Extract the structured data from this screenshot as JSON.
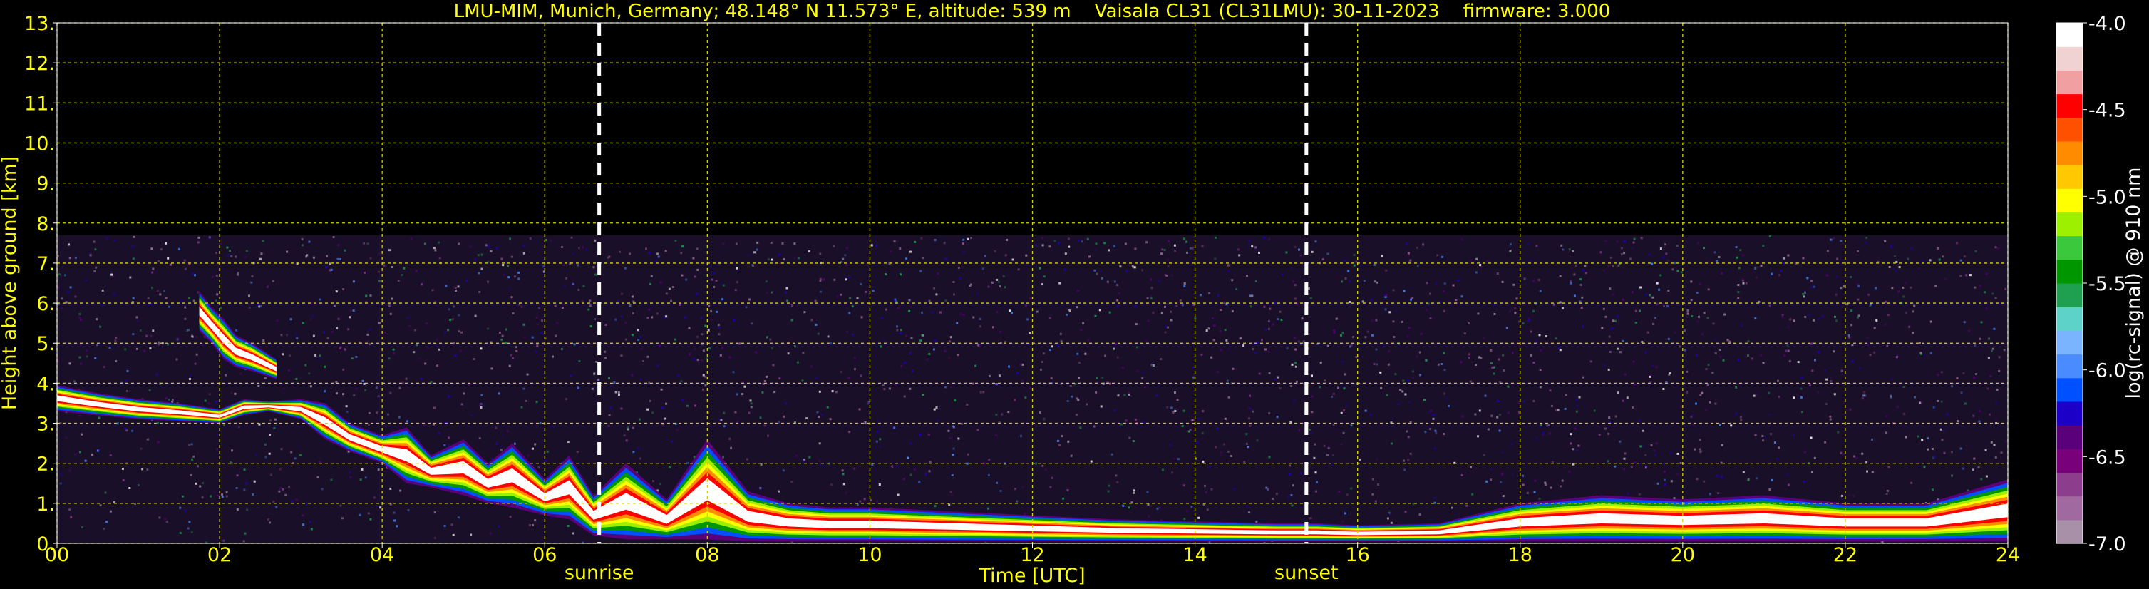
{
  "chart_data": {
    "type": "heatmap",
    "title": "LMU-MIM, Munich, Germany; 48.148° N 11.573° E, altitude: 539 m    Vaisala CL31 (CL31LMU): 30-11-2023    firmware: 3.000",
    "xlabel": "Time [UTC]",
    "ylabel": "Height above ground [km]",
    "xlim": [
      0,
      24
    ],
    "ylim": [
      0,
      13
    ],
    "x_ticks": [
      0,
      2,
      4,
      6,
      8,
      10,
      12,
      14,
      16,
      18,
      20,
      22,
      24
    ],
    "x_tick_labels": [
      "00",
      "02",
      "04",
      "06",
      "08",
      "10",
      "12",
      "14",
      "16",
      "18",
      "20",
      "22",
      "24"
    ],
    "y_ticks": [
      0,
      1,
      2,
      3,
      4,
      5,
      6,
      7,
      8,
      9,
      10,
      11,
      12,
      13
    ],
    "y_tick_labels": [
      "0.",
      "1.",
      "2.",
      "3.",
      "4.",
      "5.",
      "6.",
      "7.",
      "8.",
      "9.",
      "10.",
      "11.",
      "12.",
      "13."
    ],
    "grid": true,
    "grid_color": "#d4d400",
    "text_color": "#ffff00",
    "background": "#000000",
    "max_range_km": 7.7,
    "annotations": [
      {
        "label": "sunrise",
        "x": 6.67
      },
      {
        "label": "sunset",
        "x": 15.37
      }
    ],
    "colorbar": {
      "label": "log(rc-signal) @ 910 nm",
      "range": [
        -7.0,
        -4.0
      ],
      "tick_values": [
        -4.0,
        -4.5,
        -5.0,
        -5.5,
        -6.0,
        -6.5,
        -7.0
      ],
      "tick_labels": [
        "-4.0",
        "-4.5",
        "-5.0",
        "-5.5",
        "-6.0",
        "-6.5",
        "-7.0"
      ],
      "colors": [
        "#a890a8",
        "#a06aa0",
        "#8c3d8c",
        "#780078",
        "#5a007a",
        "#1c00c8",
        "#0050ff",
        "#4a8cff",
        "#7ab4ff",
        "#5cd2c8",
        "#1ea050",
        "#009600",
        "#3cc83c",
        "#9cf000",
        "#ffff00",
        "#ffc800",
        "#ff8c00",
        "#ff5000",
        "#ff0000",
        "#f0a0a0",
        "#f0d2d2",
        "#ffffff"
      ]
    },
    "layers": [
      {
        "name": "residual layer",
        "time": [
          0,
          0.5,
          1,
          1.5,
          2,
          2.3,
          2.6,
          3,
          3.3,
          3.6,
          4,
          4.3,
          4.6,
          5,
          5.3,
          5.6,
          6,
          6.3,
          6.6,
          7,
          7.5,
          8,
          8.5,
          9,
          9.5,
          10,
          11,
          12,
          13,
          14,
          15,
          15.5,
          16,
          17,
          18,
          19,
          20,
          21,
          22,
          23,
          24
        ],
        "top": [
          3.95,
          3.75,
          3.6,
          3.5,
          3.35,
          3.6,
          3.55,
          3.6,
          3.5,
          3.0,
          2.7,
          2.9,
          2.2,
          2.6,
          2.0,
          2.5,
          1.6,
          2.2,
          1.2,
          2.0,
          1.1,
          2.6,
          1.3,
          1.0,
          0.9,
          0.9,
          0.8,
          0.7,
          0.6,
          0.55,
          0.5,
          0.5,
          0.45,
          0.5,
          1.0,
          1.2,
          1.1,
          1.2,
          1.0,
          1.0,
          1.6
        ],
        "bottom": [
          3.3,
          3.2,
          3.1,
          3.05,
          3.0,
          3.2,
          3.3,
          3.1,
          2.6,
          2.3,
          2.0,
          1.5,
          1.4,
          1.2,
          1.0,
          0.9,
          0.7,
          0.6,
          0.2,
          0.1,
          0.1,
          0.1,
          0.05,
          0.05,
          0.05,
          0.05,
          0.05,
          0.05,
          0.05,
          0.05,
          0.05,
          0.05,
          0.05,
          0.05,
          0.05,
          0.05,
          0.05,
          0.05,
          0.05,
          0.05,
          0.05
        ]
      },
      {
        "name": "elevated aerosol",
        "time": [
          1.75,
          1.9,
          2.05,
          2.2,
          2.4,
          2.55,
          2.7
        ],
        "top": [
          6.3,
          5.9,
          5.6,
          5.2,
          5.0,
          4.8,
          4.6
        ],
        "bottom": [
          5.3,
          5.0,
          4.6,
          4.4,
          4.3,
          4.2,
          4.1
        ]
      }
    ]
  }
}
